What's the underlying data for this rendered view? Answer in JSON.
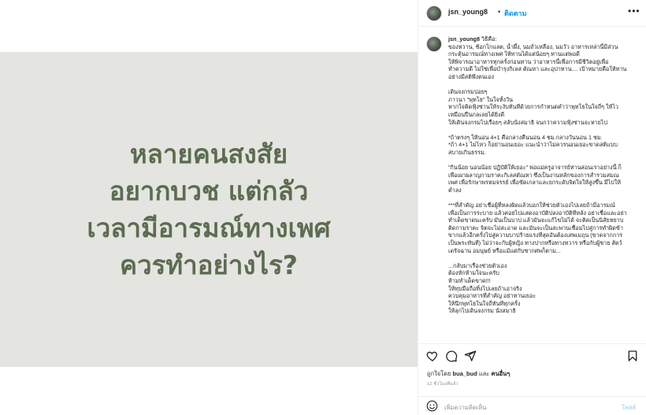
{
  "post_image": {
    "headline_lines": [
      "หลายคนสงสัย",
      "อยากบวช แต่กลัว",
      "เวลามีอารมณ์ทางเพศ",
      "ควรทำอย่างไร?"
    ],
    "text_color": "#5c6c50",
    "background_color": "#e4e4e1"
  },
  "header": {
    "username": "jsn_young8",
    "dot": "•",
    "follow_label": "ติดตาม",
    "more_label": "•••"
  },
  "caption": {
    "username": "jsn_young8",
    "first_line": "วิธีคือ:",
    "lines": [
      "ของหวาน, ช้อกโกแลต, น้ำผึ้ง, นมถั่วเหลือง, นมวัว อาหารเหล่านี้มีส่วน",
      "กระตุ้นอารมณ์ทางเพศ ให้ทานได้แต่น้อยๆ ทานแต่พอดี",
      "ให้พิจารณาอาหารทุกครั้งก่อนทาน ว่าอาหารนี้เพื่อการมีชีวิตอยู่เพื่อ",
      "ทำความดี ไม่ใช่เพื่อบำรุงกิเลส ตัณหา และอุปาทาน.... เป้าหมายคือให้ทาน",
      "อย่างมีสติพึ่งตนเอง",
      "",
      "เดินจงกรมบ่อยๆ",
      "ภาวนา \"พุทโธ\" ในใจทั้งวัน",
      "หากใจคิดฟุ้งซ่านให้ระงับทันทีด้วยการกำหนดคำว่าพุทโธในใจถี่ๆ ให้ไว",
      "เหมือนปืนกลเลยได้ยิ่งดี",
      "ให้เดินจงกรมไปเรื่อยๆ สลับนั่งสมาธิ จนกว่าความฟุ้งซ่านจะหายไป",
      "",
      "*ถ้าตรงๆ ให้นอน 4+1 คือกลางคืนนอน 4 ชม.กลางวันนอน 1 ชม.",
      "*ถ้า 4+1 ไม่ไหว ก็อย่านอนเยอะ แนะนำว่าไม่ควรนอนเยอะขาดสติแบบ",
      "สบายเกินธรรม.",
      "",
      "\"กินน้อย นอนน้อย ปฏิบัติให้เยอะ\" พ่อแม่ครูอาจารย์ท่านสอนเราอย่างนี้ ก็",
      "เพื่อเผาผลาญกามราคะกิเลสตัณหา ซึ่งเป็นงานหลักของการสำรวมสมณ",
      "เพศ เพื่อรักษาพรหมจรรย์ เพื่อขัดเกลาและยกระดับจิตใจให้สูงขึ้น มีไปให้",
      "ต่ำลง",
      "",
      "***ที่สำคัญ อย่าเชื่อผู้ที่หลงผิดแล้วบอกให้ช่วยตัวเองไปเลยถ้ามีอารมณ์",
      "เพื่อเป็นการระบาย แล้วค่อยไปแสดงอาบัติปลงอาบัติทีหลัง อย่าเชื่อและอย่า",
      "ทำเด็ดขาดนะครับ มันเป็นบาป แล้วมันจะแก้ไขไม่ได้ จะติดเป็นนิสัยหยาบ",
      "ติดกามราคะ จิตจะไม่สะอาด และมันจะเป็นสะพานเชื่อมไปสู่การทำผิดข้า",
      "ขากแล้วอีกครั้งไปสู่ความบาปร้ายแรงที่สุดอันต้องเสพเมถุน (ขาดจากการ",
      "เป็นพระทันที) ไม่ว่าจะกับผู้หญิง ทางปากหรือทางทวาร หรือกับผู้ชาย สัตว์",
      "เดรัจฉาน อมนุษย์ หรือแม้แต่กับซากศพก็ตาม...",
      "",
      "...กลับมาเรื่องช่วยตัวเอง",
      "ต้องหักห้ามใจนะครับ",
      "ห้ามทำเด็ดขาด!!!",
      "ให้ทุบมือถือทิ้งไปเลยถ้าเอาจริง",
      "ควบคุมอาหารที่สำคัญ อย่าทานเยอะ",
      "ให้นึกพุทโธในใจถี่ทันทีทุกครั้ง",
      "ให้ลุกไปเดินจงกรม นั่งสมาธิ"
    ]
  },
  "actions": {
    "like_icon": "heart-icon",
    "comment_icon": "comment-bubble-icon",
    "share_icon": "paper-plane-icon",
    "save_icon": "bookmark-icon"
  },
  "likes": {
    "prefix": "ถูกใจโดย",
    "user": "bua_bud",
    "middle": "และ",
    "others": "คนอื่นๆ"
  },
  "time_label": "12 ชั่วโมงที่แล้ว",
  "comment": {
    "emoji_icon": "smiley-icon",
    "placeholder": "เพิ่มความคิดเห็น",
    "post_label": "โพสต์"
  }
}
